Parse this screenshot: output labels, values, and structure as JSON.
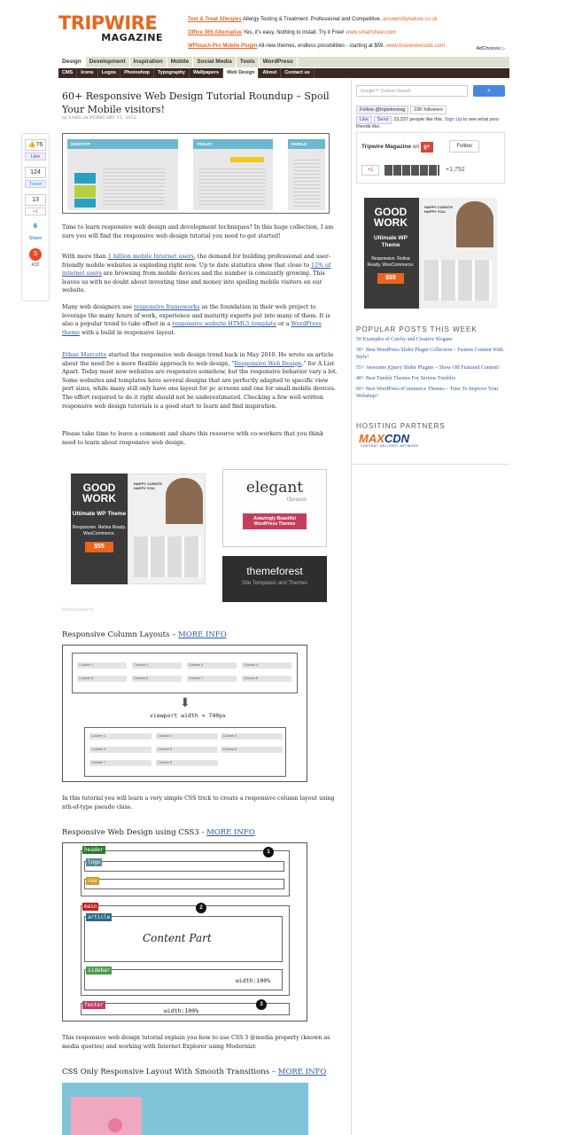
{
  "header": {
    "logo_top": "TRIPWIRE",
    "logo_bottom": "MAGAZINE",
    "ads": [
      {
        "title": "Test & Treat Allergies",
        "text": " Allergy Testing & Treatment. Professional and Competitive. ",
        "url": "answersbynature.co.uk"
      },
      {
        "title": "Office 365 Alternative",
        "text": " Yes, it's easy. Nothing to install. Try it Free! ",
        "url": "www.smartsheet.com"
      },
      {
        "title": "WPtouch Pro Mobile Plugin",
        "text": " All-new themes, endless possibilities - starting at $59. ",
        "url": "www.bravenewcode.com"
      }
    ],
    "adchoices": "AdChoices ▷"
  },
  "nav": {
    "primary": [
      "Design",
      "Development",
      "Inspiration",
      "Mobile",
      "Social Media",
      "Tools",
      "WordPress"
    ],
    "secondary": [
      "CMS",
      "Icons",
      "Logos",
      "Photoshop",
      "Typography",
      "Wallpapers",
      "Web Design",
      "About",
      "Contact us"
    ]
  },
  "share": {
    "like_count": "76",
    "like_label": "Like",
    "tweet_count": "124",
    "tweet_label": "Tweet",
    "plus_count": "13",
    "plus_label": "+1",
    "li_count": "6",
    "li_label": "Share",
    "su_count": "432"
  },
  "article": {
    "title": "60+ Responsive Web Design Tutorial Roundup – Spoil Your Mobile visitors!",
    "byline": "by LARS on FEBRUARY 15, 2012",
    "hero_labels": [
      "DESKTOP",
      "TABLET",
      "MOBILE"
    ],
    "p1": "Time to learn responsive web design and development techniques? In this huge collection, I am sure you will find the responsive web design tutorial you need to get started!",
    "p2_a": "With more than ",
    "p2_link1": "1 billion mobile Internet users",
    "p2_b": ", the demand for building professional and user-friendly mobile websites is exploding right now. Up to date statistics show that close to ",
    "p2_link2": "12% of internet users",
    "p2_c": " are browsing from mobile devices and the number is constantly growing. This leaves us with no doubt about investing time and money into spoiling mobile visitors on our website.",
    "p3_a": "Many web designers use ",
    "p3_link1": "responsive frameworks",
    "p3_b": " as the foundation in their web project to leverage the many hours of work, experience and maturity experts put into many of them. It is also a popular trend to take offset in a ",
    "p3_link2": "responsive website HTML5 template",
    "p3_c": " or a ",
    "p3_link3": "WordPress theme",
    "p3_d": " with a build in responsive layout.",
    "p4_link1": "Ethan Marcotte",
    "p4_a": " started the responsive web design trend back in May 2010. He wrote an article about the need for a more flexible approach to web design, “",
    "p4_link2": "Responsive Web Design",
    "p4_b": ",” for A List Apart. Today most new websites are responsive somehow, but the responsive behavior vary a lot. Some websites and templates have several designs that are perfectly adapted to specific view port sizes, while many still only have one layout for pc screens and one for small mobile devices. The effort required to do it right should not be underestimated. Checking a few well-written responsive web design tutorials is a good start to learn and find inspiration.",
    "p5": "Please take time to leave a comment and share this resource with co-workers that you think need to learn about responsive web design.",
    "advertisement": "Advertisement"
  },
  "promo": {
    "gw_head": "GOOD WORK",
    "gw_sub": "Ultimate WP Theme",
    "gw_desc": "Responsive. Retina Ready. WooCommerce.",
    "gw_price": "$55",
    "gw_banner": "HAPPY CLIENTS HAPPY YOU.",
    "elegant_name": "elegant",
    "elegant_sub": "themes",
    "elegant_banner": "Amazingly Beautiful WordPress Themes",
    "tf_name": "themeforest",
    "tf_sub": "Site Templates and Themes"
  },
  "sections": [
    {
      "title": "Responsive Column Layouts – ",
      "link": "MORE INFO",
      "desc": "In this tutorial you will learn a very simple CSS trick to create a responsive column layout using nth-of-type pseudo class."
    },
    {
      "title": "Responsive Web Design using CSS3 -  ",
      "link": "MORE INFO",
      "desc": "This responsive web design tutorial explain you how to use CSS 3 @media property (known as media queries) and working with Internet Explorer using Modernizr."
    },
    {
      "title": "CSS Only Responsive Layout With Smooth Transitions – ",
      "link": "MORE INFO"
    }
  ],
  "fig1": {
    "top": [
      "Column 1",
      "Column 2",
      "Column 3",
      "Column 4",
      "Column 5",
      "Column 6",
      "Column 7",
      "Column 8"
    ],
    "arrow_label": "viewport width < 740px",
    "bottom": [
      "Column 1",
      "Column 2",
      "Column 3",
      "Column 4",
      "Column 5",
      "Column 6",
      "Column 7",
      "Column 8"
    ]
  },
  "fig2": {
    "tags": [
      "header",
      "logo",
      "nav",
      "main",
      "article",
      "sidebar",
      "footer"
    ],
    "content": "Content Part",
    "width1": "width:100%",
    "width2": "width:100%",
    "nums": [
      "1",
      "2",
      "3"
    ]
  },
  "sidebar": {
    "search_placeholder": "Google™ Custom Search",
    "follow": "Follow @tripwiremag",
    "followers": "23K followers",
    "fb_like": "Like",
    "fb_send": "Send",
    "fb_text_a": "23,337 people like this. ",
    "fb_signup": "Sign Up",
    "fb_text_b": " to see what your friends like.",
    "gp_name": "Tripwire Magazine",
    "gp_on": " on ",
    "gp_follow": "Follow",
    "gp_plus": "+1",
    "gp_count": "+1,752",
    "popular_title": "POPULAR POSTS THIS WEEK",
    "popular": [
      "50 Examples of Catchy and Creative Slogans",
      "50+ Best WordPress Slider Plugin Collection – Feature Content With Style!",
      "55+ Awesome jQuery Slider Plugins – Show Off Featured Content!",
      "40+ Best Tumblr Themes For Serious Tumblrs",
      "60+ Best WordPress eCommerce Themes – Time To Improve Your Webshop?"
    ],
    "hosting_title": "HOSITING PARTNERS",
    "maxcdn_a": "MAX",
    "maxcdn_b": "CDN",
    "maxcdn_sub": "CONTENT DELIVERY NETWORK"
  },
  "colors": {
    "brand": "#e8651e",
    "link": "#2a5aa0",
    "nav_dark": "#3a2a24"
  }
}
